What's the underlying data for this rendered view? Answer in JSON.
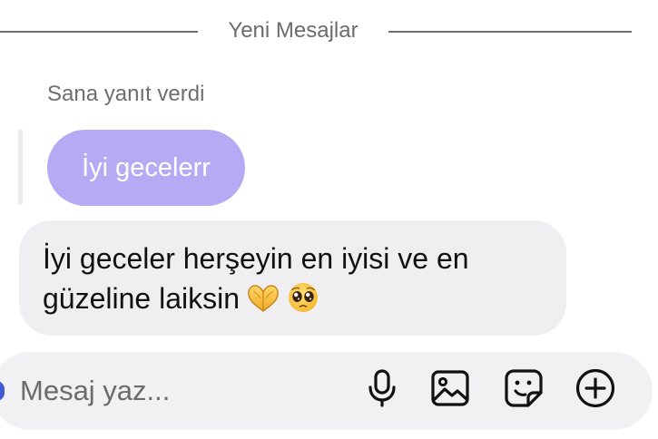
{
  "divider": {
    "label": "Yeni Mesajlar"
  },
  "reply": {
    "label": "Sana yanıt verdi",
    "quoted_text": "İyi gecelerr"
  },
  "message": {
    "line1": "İyi geceler herşeyin en iyisi ve en",
    "line2": "güzeline laiksin",
    "emojis": [
      "heart-hands",
      "pleading-face"
    ]
  },
  "composer": {
    "placeholder": "Mesaj yaz...",
    "icons": [
      "microphone-icon",
      "image-icon",
      "sticker-icon",
      "plus-circle-icon"
    ]
  },
  "colors": {
    "quoted_bubble": "#b5aaf3",
    "message_bubble": "#efeff1",
    "composer_bg": "#f1f1f3"
  }
}
